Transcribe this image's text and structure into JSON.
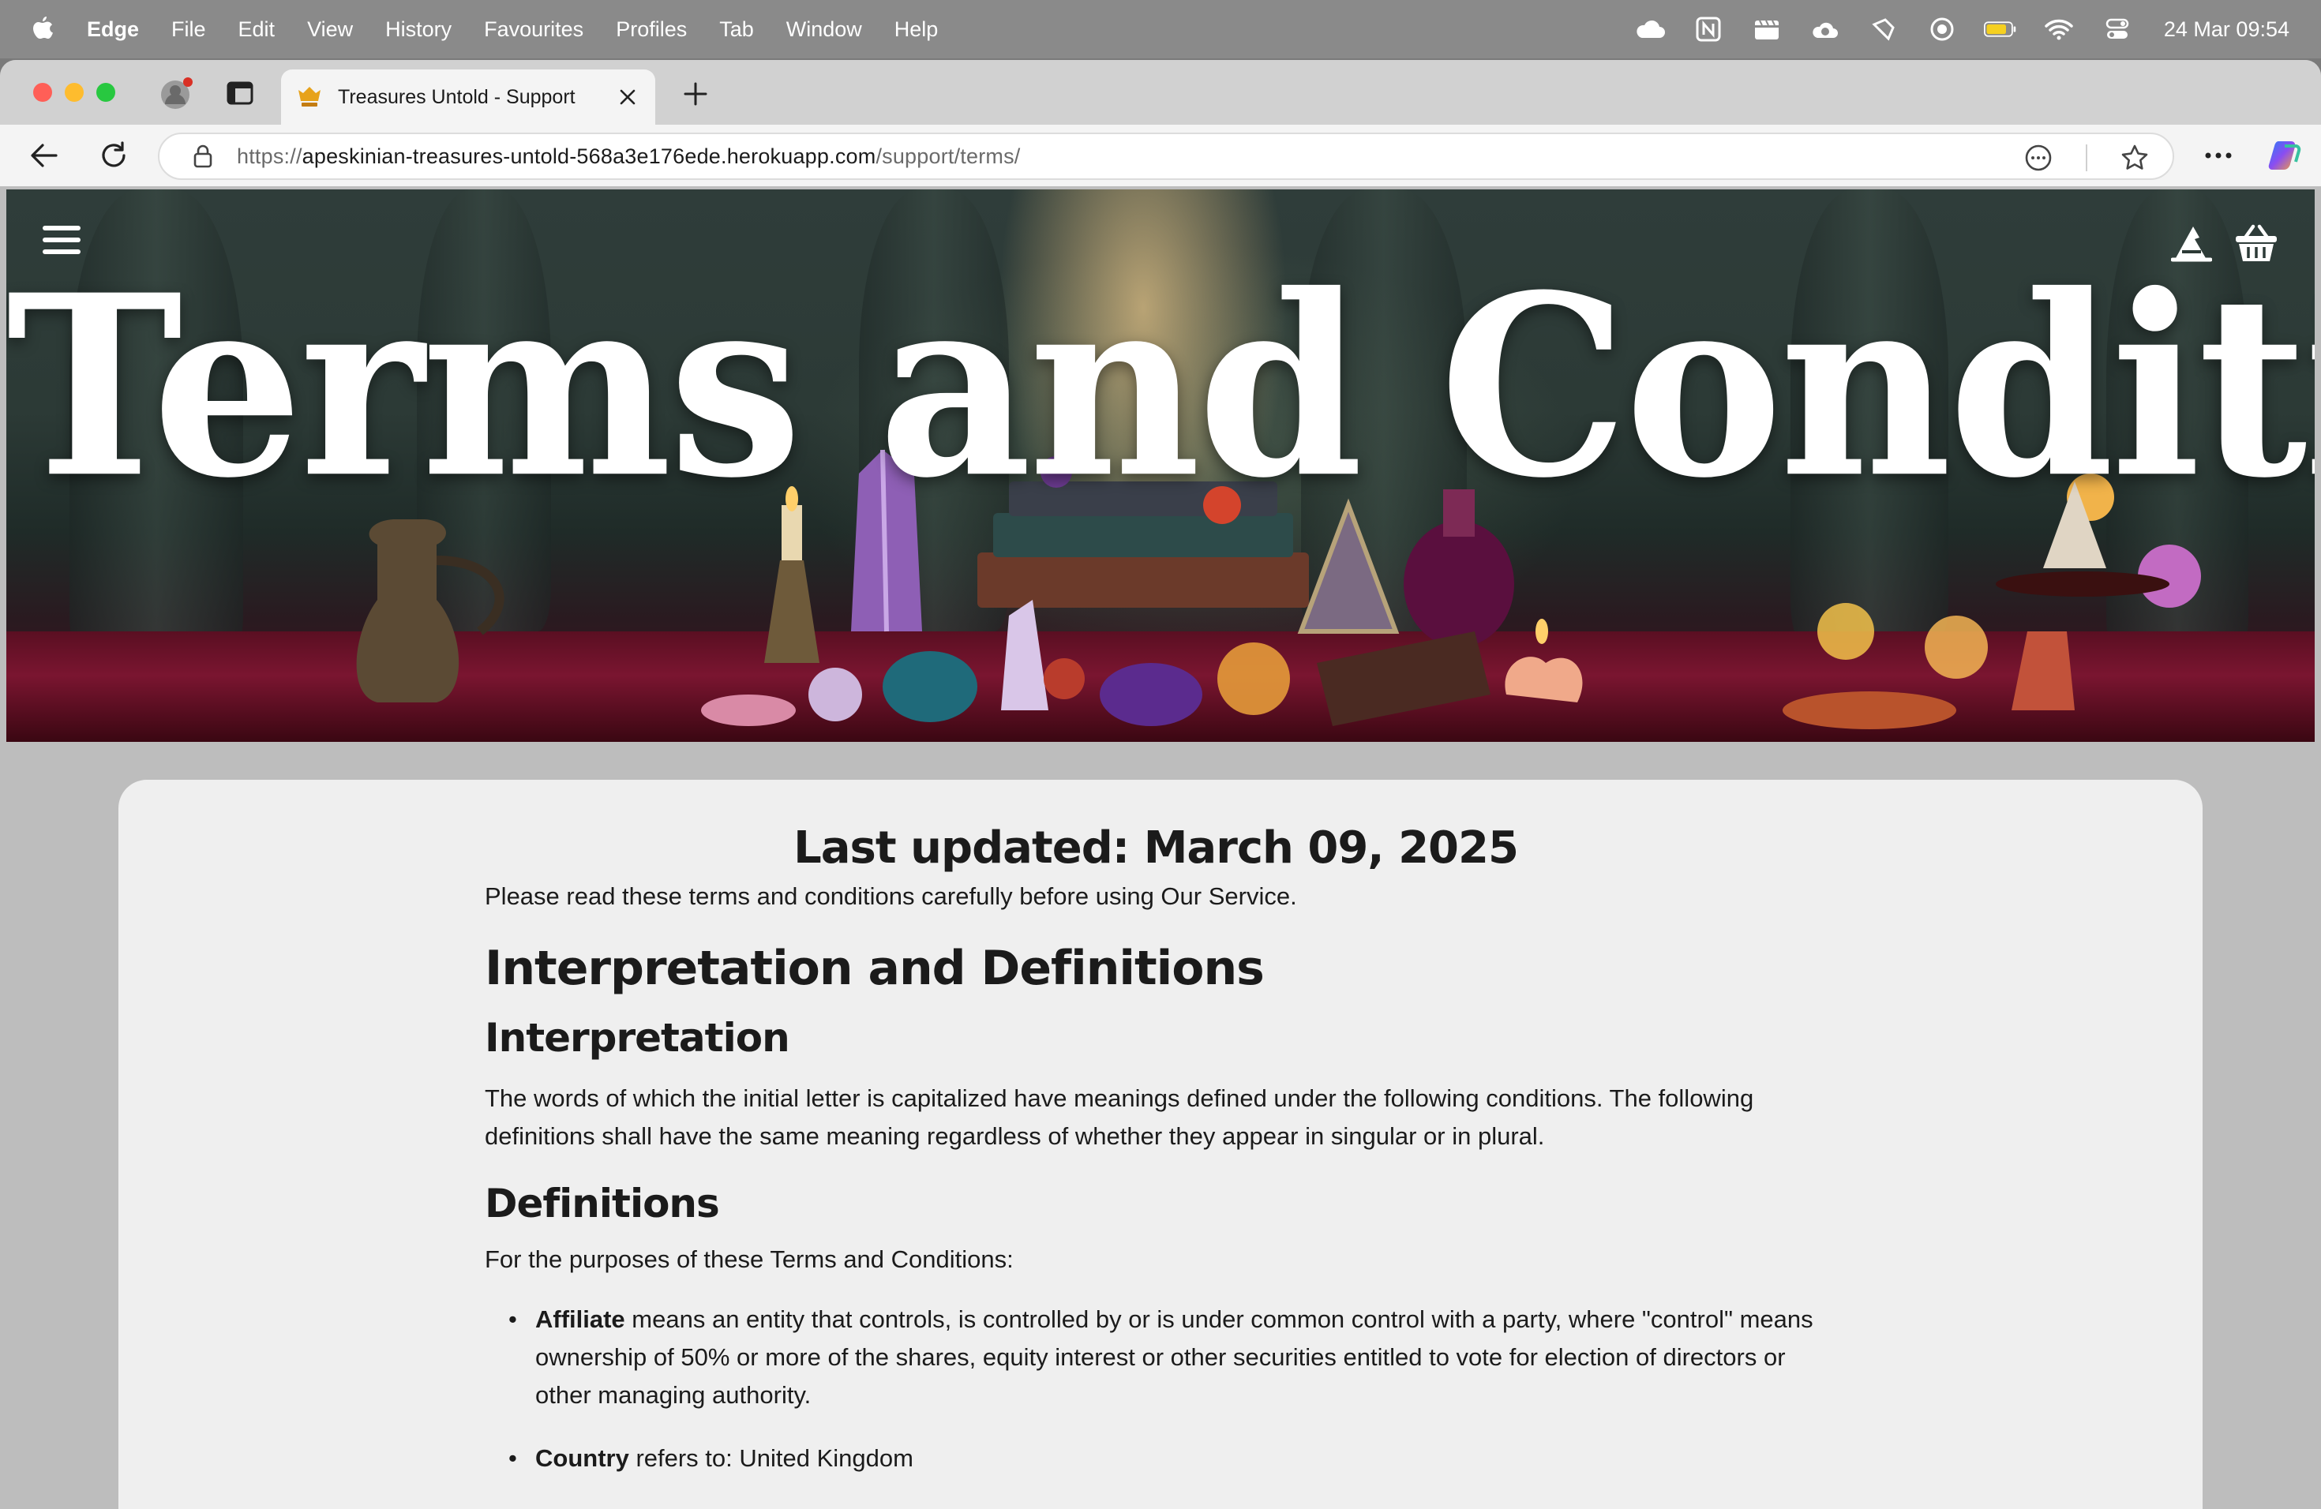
{
  "menubar": {
    "app_name": "Edge",
    "items": [
      "File",
      "Edit",
      "View",
      "History",
      "Favourites",
      "Profiles",
      "Tab",
      "Window",
      "Help"
    ],
    "clock": "24 Mar  09:54"
  },
  "browser": {
    "tab_title": "Treasures Untold - Support",
    "url_prefix": "https://",
    "url_host": "apeskinian-treasures-untold-568a3e176ede.herokuapp.com",
    "url_path": "/support/terms/"
  },
  "hero": {
    "title": "Terms and Conditions"
  },
  "page": {
    "last_updated": "Last updated: March 09, 2025",
    "intro": "Please read these terms and conditions carefully before using Our Service.",
    "section_heading": "Interpretation and Definitions",
    "interpretation_heading": "Interpretation",
    "interpretation_text": "The words of which the initial letter is capitalized have meanings defined under the following conditions. The following definitions shall have the same meaning regardless of whether they appear in singular or in plural.",
    "definitions_heading": "Definitions",
    "definitions_intro": "For the purposes of these Terms and Conditions:",
    "definitions": [
      {
        "term": "Affiliate",
        "text": " means an entity that controls, is controlled by or is under common control with a party, where \"control\" means ownership of 50% or more of the shares, equity interest or other securities entitled to vote for election of directors or other managing authority."
      },
      {
        "term": "Country",
        "text": " refers to: United Kingdom"
      }
    ]
  },
  "icons": {
    "menu": "hamburger-icon",
    "account": "witch-hat-icon",
    "basket": "basket-icon"
  },
  "colors": {
    "close": "#ff5f57",
    "minimize": "#febc2e",
    "maximize": "#28c840",
    "card_bg": "#efefef"
  }
}
